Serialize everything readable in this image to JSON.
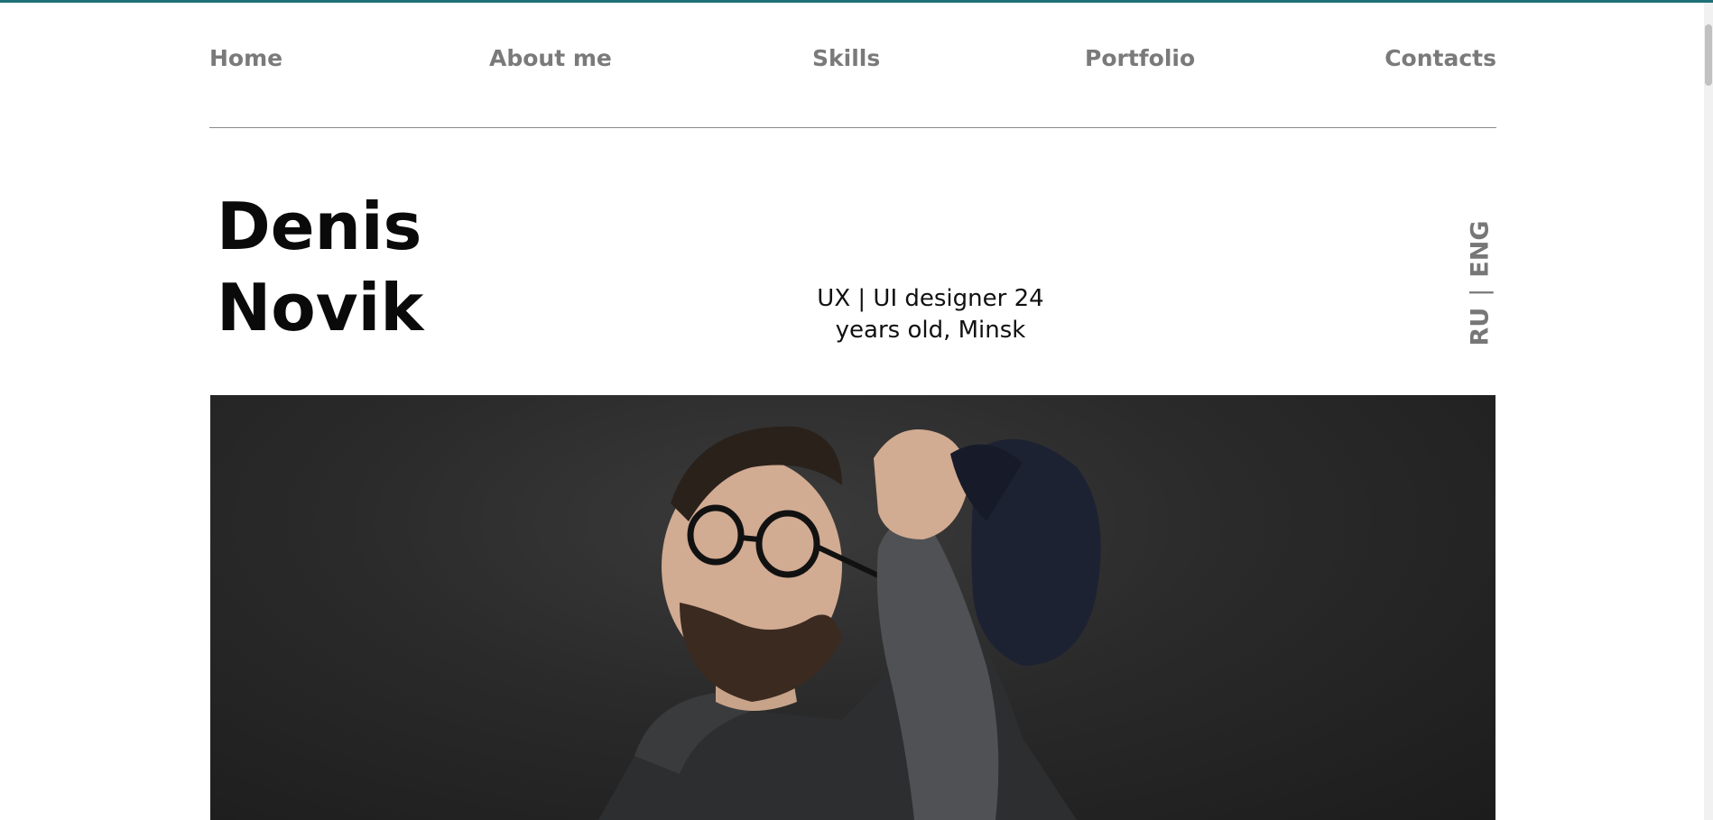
{
  "nav": {
    "items": [
      {
        "label": "Home"
      },
      {
        "label": "About me"
      },
      {
        "label": "Skills"
      },
      {
        "label": "Portfolio"
      },
      {
        "label": "Contacts"
      }
    ]
  },
  "hero": {
    "first_name": "Denis",
    "last_name": "Novik",
    "tagline_line1": "UX | UI designer 24",
    "tagline_line2": "years old, Minsk"
  },
  "lang": {
    "ru": "RU",
    "separator": "|",
    "eng": "ENG"
  },
  "colors": {
    "accent_bar": "#1f6f78",
    "nav_text": "#7a7a7a",
    "photo_background": "#2a2a2a"
  }
}
